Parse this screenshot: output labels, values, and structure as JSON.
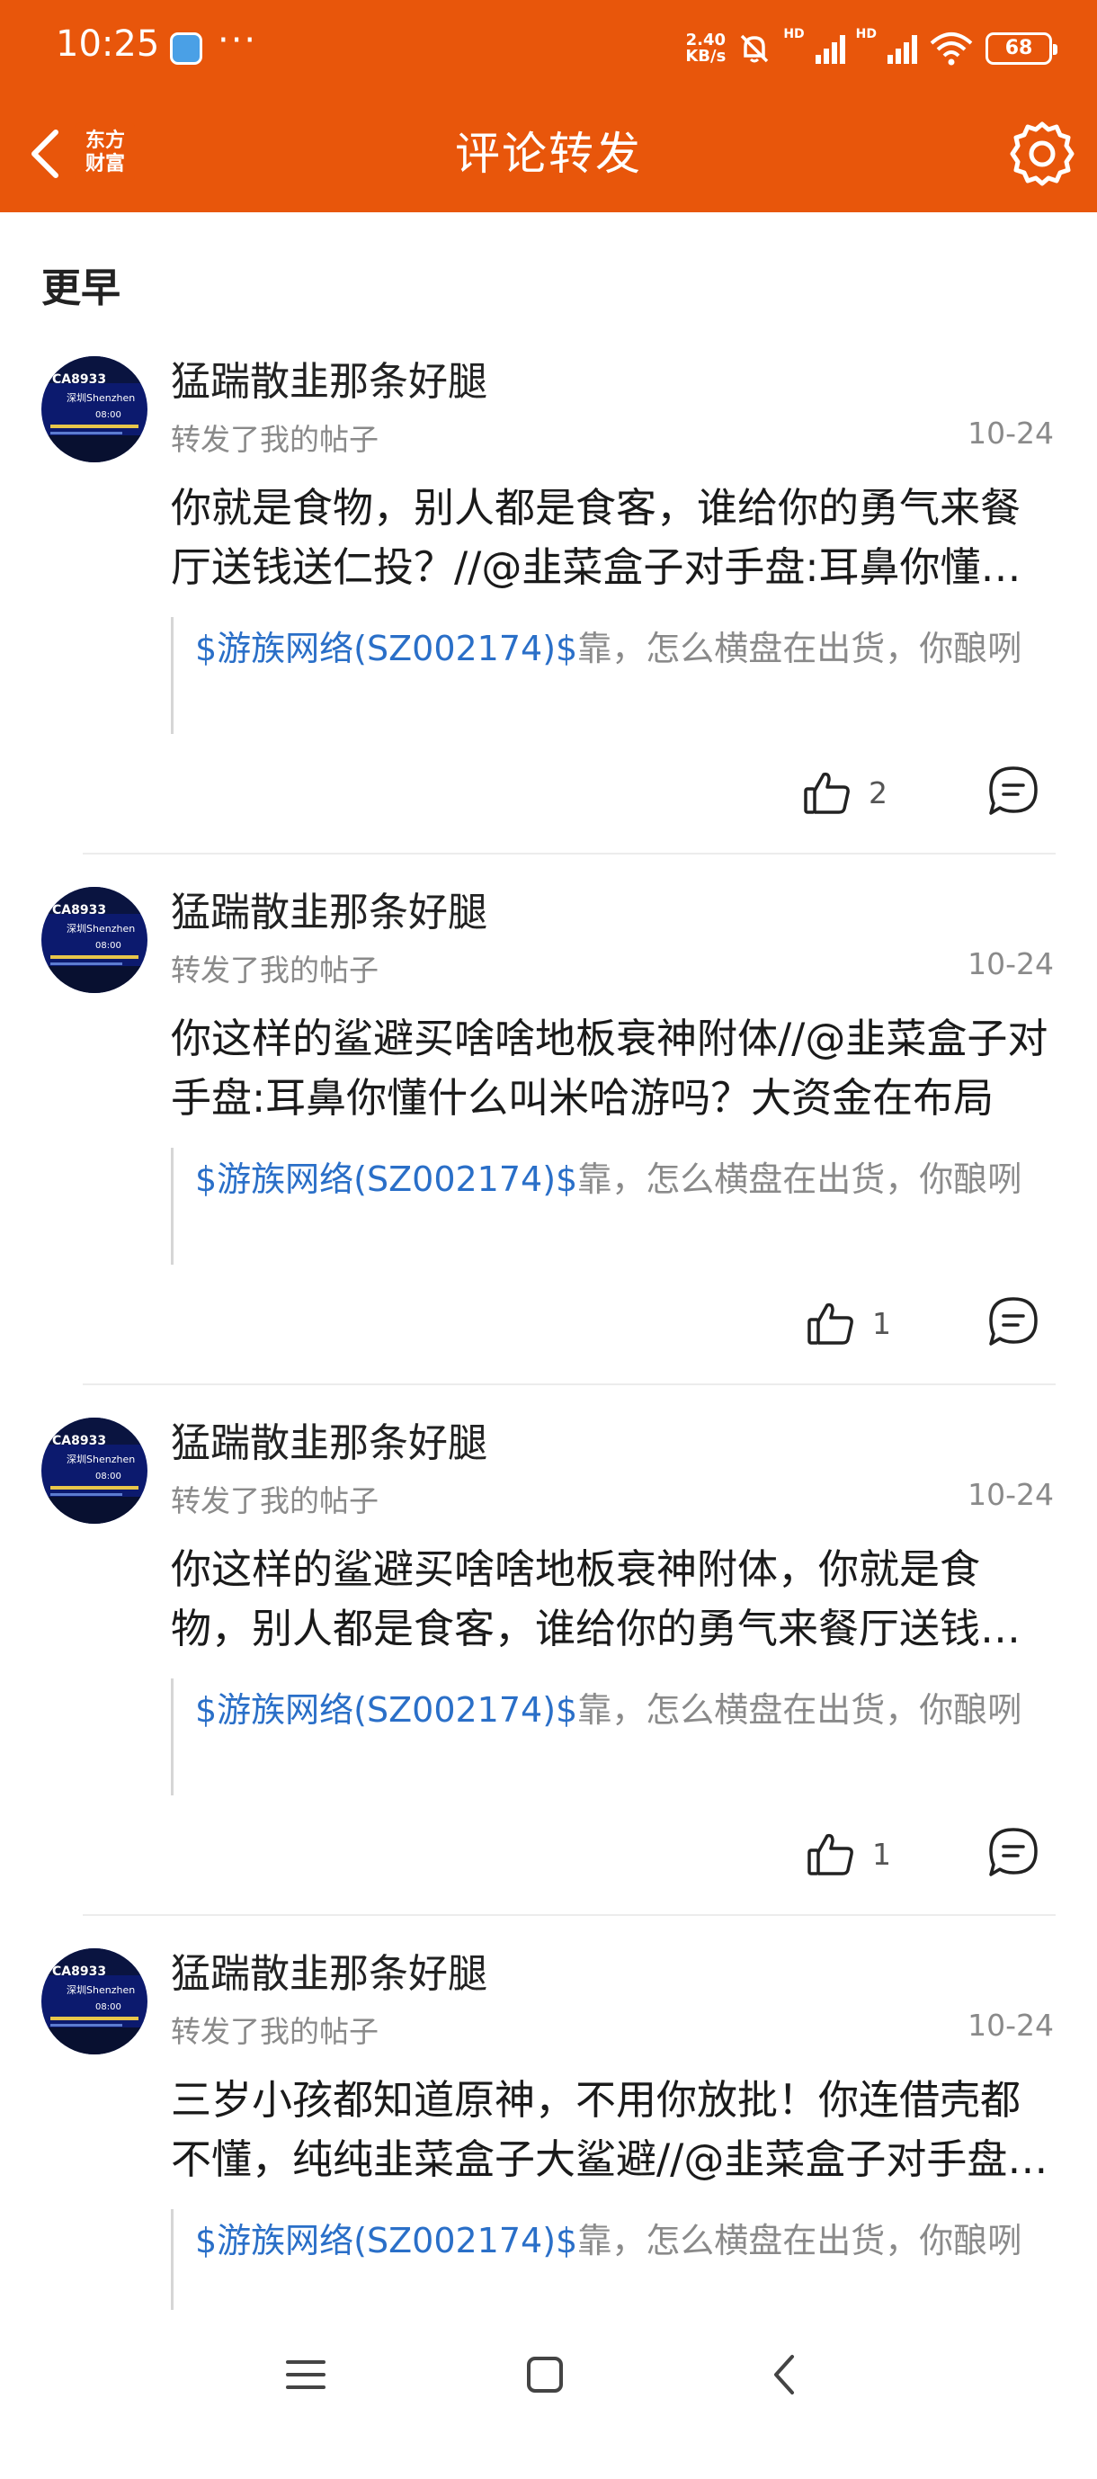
{
  "status_bar": {
    "time": "10:25",
    "dots": "···",
    "net_speed_value": "2.40",
    "net_speed_unit": "KB/s",
    "hd_label": "HD",
    "battery": "68"
  },
  "nav": {
    "title": "评论转发",
    "logo_line1": "东方",
    "logo_line2": "财富"
  },
  "section_title": "更早",
  "posts": [
    {
      "username": "猛踹散韭那条好腿",
      "subtitle": "转发了我的帖子",
      "date": "10-24",
      "text": "你就是食物，别人都是食客，谁给你的勇气来餐厅送钱送仁投？//@韭菜盒子对手盘:耳鼻你懂什么叫米哈游吗？大资金在布局",
      "quote_stock": "$游族网络(SZ002174)$",
      "quote_text": "靠，怎么横盘在出货，你酿咧",
      "likes": "2"
    },
    {
      "username": "猛踹散韭那条好腿",
      "subtitle": "转发了我的帖子",
      "date": "10-24",
      "text": "你这样的鲨避买啥啥地板衰神附体//@韭菜盒子对手盘:耳鼻你懂什么叫米哈游吗？大资金在布局",
      "quote_stock": "$游族网络(SZ002174)$",
      "quote_text": "靠，怎么横盘在出货，你酿咧",
      "likes": "1"
    },
    {
      "username": "猛踹散韭那条好腿",
      "subtitle": "转发了我的帖子",
      "date": "10-24",
      "text": "你这样的鲨避买啥啥地板衰神附体，你就是食物，别人都是食客，谁给你的勇气来餐厅送钱送仁投？",
      "quote_stock": "$游族网络(SZ002174)$",
      "quote_text": "靠，怎么横盘在出货，你酿咧",
      "likes": "1"
    },
    {
      "username": "猛踹散韭那条好腿",
      "subtitle": "转发了我的帖子",
      "date": "10-24",
      "text": "三岁小孩都知道原神，不用你放批！你连借壳都不懂，纯纯韭菜盒子大鲨避//@韭菜盒子对手盘:耳鼻你懂什么叫米哈游吗？",
      "quote_stock": "$游族网络(SZ002174)$",
      "quote_text": "靠，怎么横盘在出货，你酿咧",
      "likes": ""
    }
  ],
  "avatar": {
    "line1": "CA8933",
    "line2": "深圳Shenzhen",
    "line3": "08:00"
  },
  "colors": {
    "accent": "#e8560b",
    "link": "#2a6fc8",
    "muted": "#8a8a8a"
  }
}
